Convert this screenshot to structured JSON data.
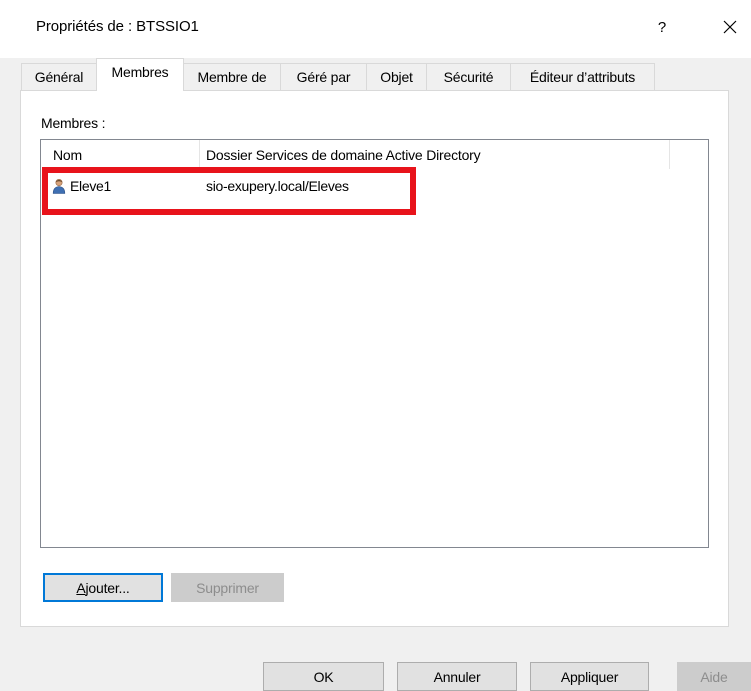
{
  "window": {
    "title": "Propriétés de : BTSSIO1",
    "help_label": "?"
  },
  "tabs": [
    {
      "label": "Général",
      "active": false
    },
    {
      "label": "Membres",
      "active": true
    },
    {
      "label": "Membre de",
      "active": false
    },
    {
      "label": "Géré par",
      "active": false
    },
    {
      "label": "Objet",
      "active": false
    },
    {
      "label": "Sécurité",
      "active": false
    },
    {
      "label": "Éditeur d’attributs",
      "active": false
    }
  ],
  "members": {
    "label": "Membres :",
    "columns": [
      "Nom",
      "Dossier Services de domaine Active Directory"
    ],
    "rows": [
      {
        "name": "Eleve1",
        "folder": "sio-exupery.local/Eleves",
        "icon": "user-icon"
      }
    ],
    "highlight_color": "#e8131b"
  },
  "buttons": {
    "add_first": "A",
    "add_rest": "jouter...",
    "remove": "Supprimer",
    "ok": "OK",
    "cancel": "Annuler",
    "apply": "Appliquer",
    "help": "Aide"
  },
  "colors": {
    "accent": "#0078d7",
    "dialog_bg": "#f0f0f0",
    "highlight": "#e8131b"
  }
}
